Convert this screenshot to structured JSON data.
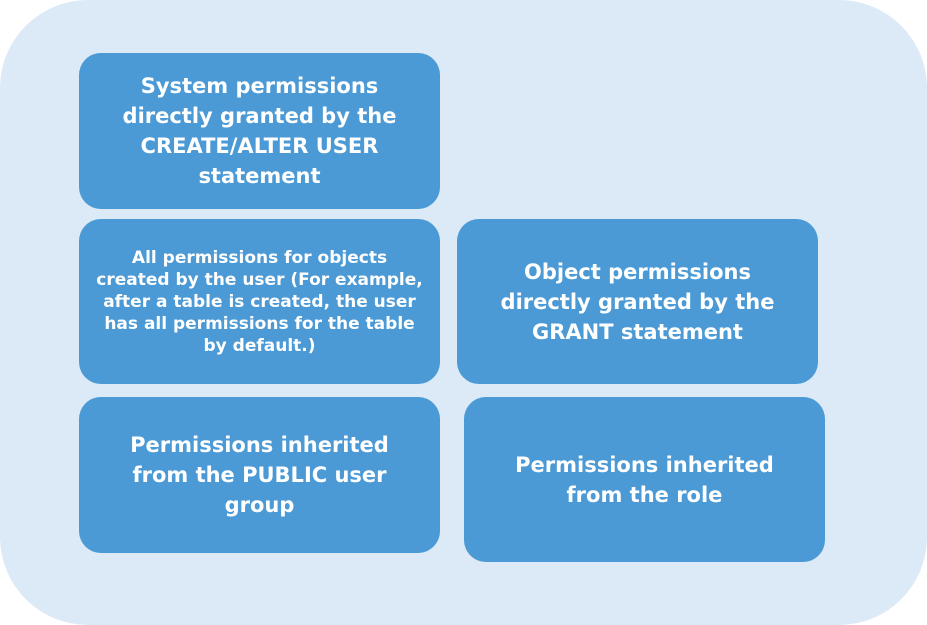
{
  "diagram": {
    "boxes": {
      "system_permissions": "System permissions directly granted by the CREATE/ALTER USER statement",
      "created_objects": "All permissions for objects created by the user (For example, after a table is created, the user has all permissions for the table by default.)",
      "object_permissions": "Object permissions directly granted by the GRANT statement",
      "public_group": "Permissions inherited from the PUBLIC user group",
      "role": "Permissions inherited from the role"
    }
  },
  "colors": {
    "panel_background": "#dbeaf6",
    "box_fill": "#4b9ad5",
    "box_text": "#ffffff"
  }
}
